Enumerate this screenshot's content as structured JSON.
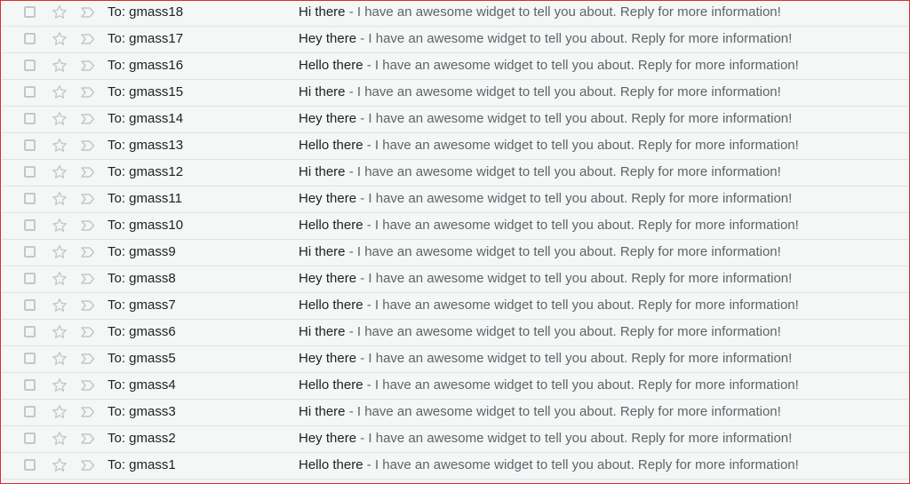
{
  "colors": {
    "frame_border": "#d93025",
    "row_bg": "#f5f7f7",
    "icon": "#c4c7c9"
  },
  "icons": {
    "checkbox": "checkbox-icon",
    "star": "star-icon",
    "importance": "importance-marker-icon"
  },
  "separator": " - ",
  "rows": [
    {
      "to": "To: gmass18",
      "subject": "Hi there",
      "snippet": "I have an awesome widget to tell you about. Reply for more information!"
    },
    {
      "to": "To: gmass17",
      "subject": "Hey there",
      "snippet": "I have an awesome widget to tell you about. Reply for more information!"
    },
    {
      "to": "To: gmass16",
      "subject": "Hello there",
      "snippet": "I have an awesome widget to tell you about. Reply for more information!"
    },
    {
      "to": "To: gmass15",
      "subject": "Hi there",
      "snippet": "I have an awesome widget to tell you about. Reply for more information!"
    },
    {
      "to": "To: gmass14",
      "subject": "Hey there",
      "snippet": "I have an awesome widget to tell you about. Reply for more information!"
    },
    {
      "to": "To: gmass13",
      "subject": "Hello there",
      "snippet": "I have an awesome widget to tell you about. Reply for more information!"
    },
    {
      "to": "To: gmass12",
      "subject": "Hi there",
      "snippet": "I have an awesome widget to tell you about. Reply for more information!"
    },
    {
      "to": "To: gmass11",
      "subject": "Hey there",
      "snippet": "I have an awesome widget to tell you about. Reply for more information!"
    },
    {
      "to": "To: gmass10",
      "subject": "Hello there",
      "snippet": "I have an awesome widget to tell you about. Reply for more information!"
    },
    {
      "to": "To: gmass9",
      "subject": "Hi there",
      "snippet": "I have an awesome widget to tell you about. Reply for more information!"
    },
    {
      "to": "To: gmass8",
      "subject": "Hey there",
      "snippet": "I have an awesome widget to tell you about. Reply for more information!"
    },
    {
      "to": "To: gmass7",
      "subject": "Hello there",
      "snippet": "I have an awesome widget to tell you about. Reply for more information!"
    },
    {
      "to": "To: gmass6",
      "subject": "Hi there",
      "snippet": "I have an awesome widget to tell you about. Reply for more information!"
    },
    {
      "to": "To: gmass5",
      "subject": "Hey there",
      "snippet": "I have an awesome widget to tell you about. Reply for more information!"
    },
    {
      "to": "To: gmass4",
      "subject": "Hello there",
      "snippet": "I have an awesome widget to tell you about. Reply for more information!"
    },
    {
      "to": "To: gmass3",
      "subject": "Hi there",
      "snippet": "I have an awesome widget to tell you about. Reply for more information!"
    },
    {
      "to": "To: gmass2",
      "subject": "Hey there",
      "snippet": "I have an awesome widget to tell you about. Reply for more information!"
    },
    {
      "to": "To: gmass1",
      "subject": "Hello there",
      "snippet": "I have an awesome widget to tell you about. Reply for more information!"
    }
  ]
}
